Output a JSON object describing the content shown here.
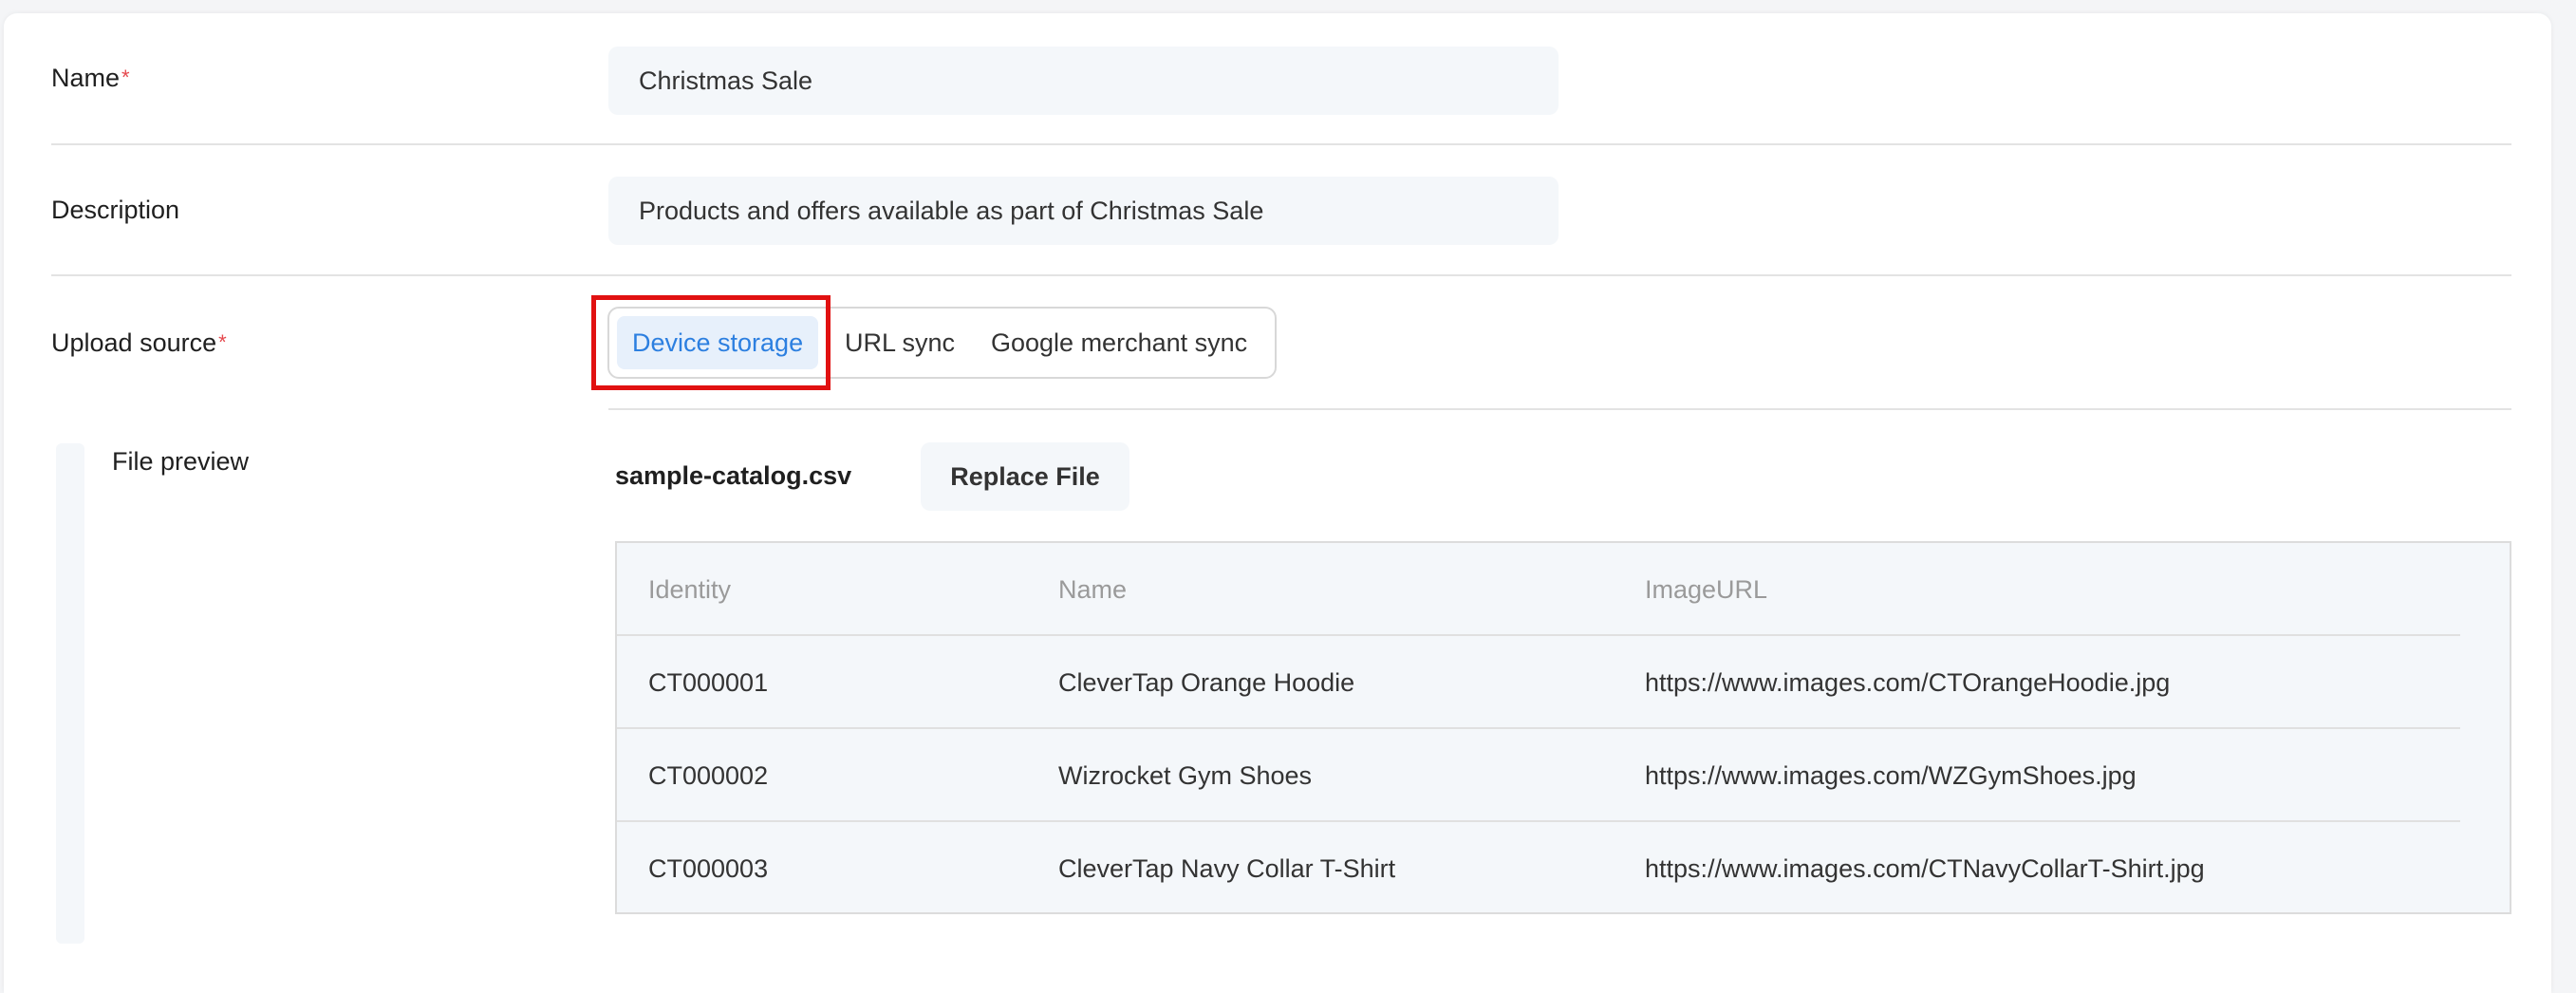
{
  "form": {
    "name": {
      "label": "Name",
      "required_mark": "*",
      "value": "Christmas Sale"
    },
    "description": {
      "label": "Description",
      "value": "Products and offers available as part of Christmas Sale"
    },
    "upload_source": {
      "label": "Upload source",
      "required_mark": "*",
      "options": [
        "Device storage",
        "URL sync",
        "Google merchant sync"
      ],
      "selected": "Device storage"
    },
    "file_preview": {
      "label": "File preview",
      "file_name": "sample-catalog.csv",
      "replace_button": "Replace File",
      "table": {
        "headers": [
          "Identity",
          "Name",
          "ImageURL"
        ],
        "rows": [
          [
            "CT000001",
            "CleverTap Orange Hoodie",
            "https://www.images.com/CTOrangeHoodie.jpg"
          ],
          [
            "CT000002",
            "Wizrocket Gym Shoes",
            "https://www.images.com/WZGymShoes.jpg"
          ],
          [
            "CT000003",
            "CleverTap Navy Collar T-Shirt",
            "https://www.images.com/CTNavyCollarT-Shirt.jpg"
          ]
        ]
      }
    }
  },
  "colors": {
    "accent": "#2c7fe0",
    "required": "#e5484d",
    "highlight": "#e11111"
  }
}
